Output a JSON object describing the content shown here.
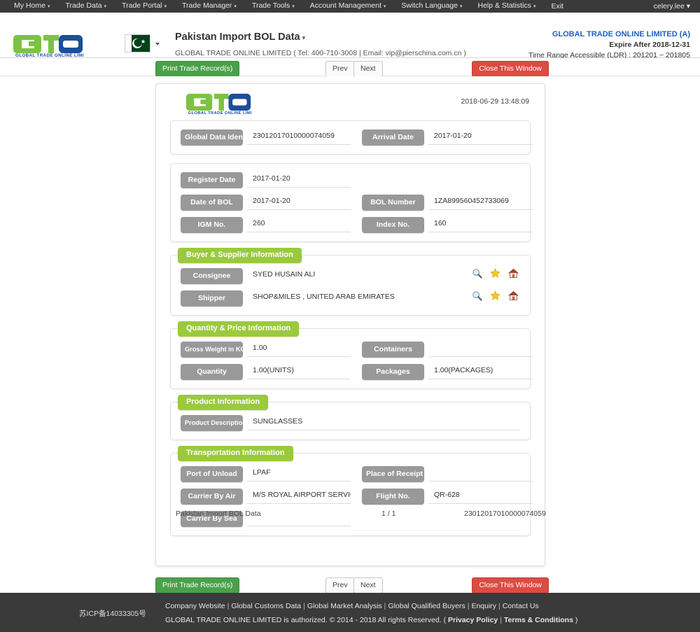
{
  "topnav": {
    "items": [
      {
        "label": "My Home",
        "caret": true
      },
      {
        "label": "Trade Data",
        "caret": true
      },
      {
        "label": "Trade Portal",
        "caret": true
      },
      {
        "label": "Trade Manager",
        "caret": true
      },
      {
        "label": "Trade Tools",
        "caret": true
      },
      {
        "label": "Account Management",
        "caret": true
      },
      {
        "label": "Switch Language",
        "caret": true
      },
      {
        "label": "Help & Statistics",
        "caret": true
      },
      {
        "label": "Exit",
        "caret": false
      }
    ],
    "user": "celery.lee"
  },
  "header": {
    "logo_text": "GLOBAL TRADE ONLINE LIMITED",
    "flag_country": "Pakistan",
    "page_title": "Pakistan Import BOL Data",
    "company_line": "GLOBAL TRADE ONLINE LIMITED ( Tel: 400-710-3008 | Email: vip@pierschina.com.cn )",
    "account_name": "GLOBAL TRADE ONLINE LIMITED (A)",
    "expire": "Expire After 2018-12-31",
    "time_range": "Time Range Accessible (LDR) : 201201 ~ 201805"
  },
  "toolbar": {
    "print_label": "Print Trade Record(s)",
    "prev_label": "Prev",
    "next_label": "Next",
    "close_label": "Close This Window"
  },
  "document": {
    "timestamp": "2018-06-29 13:48:09",
    "identity_section": {
      "rows": [
        {
          "label_left": "Global Data Identity",
          "value_left": "23012017010000074059",
          "label_right": "Arrival Date",
          "value_right": "2017-01-20"
        }
      ]
    },
    "bol_section": {
      "rows": [
        {
          "label_left": "Register Date",
          "value_left": "2017-01-20",
          "label_right": "",
          "value_right": ""
        },
        {
          "label_left": "Date of BOL",
          "value_left": "2017-01-20",
          "label_right": "BOL Number",
          "value_right": "1ZA899560452733069"
        },
        {
          "label_left": "IGM No.",
          "value_left": "260",
          "label_right": "Index No.",
          "value_right": "160"
        }
      ]
    },
    "buyer_supplier": {
      "title": "Buyer & Supplier Information",
      "rows": [
        {
          "label": "Consignee",
          "value": "SYED HUSAIN ALI"
        },
        {
          "label": "Shipper",
          "value": "SHOP&MILES , UNITED ARAB EMIRATES"
        }
      ],
      "icons": [
        "search-icon",
        "star-icon",
        "home-icon"
      ]
    },
    "quantity_price": {
      "title": "Quantity & Price Information",
      "rows": [
        {
          "label_left": "Gross Weight in KG",
          "value_left": "1.00",
          "label_right": "Containers",
          "value_right": ""
        },
        {
          "label_left": "Quantity",
          "value_left": "1.00(UNITS)",
          "label_right": "Packages",
          "value_right": "1.00(PACKAGES)"
        }
      ]
    },
    "product": {
      "title": "Product Information",
      "rows": [
        {
          "label": "Product Description",
          "value": "SUNGLASSES"
        }
      ]
    },
    "transportation": {
      "title": "Transportation Information",
      "rows": [
        {
          "label_left": "Port of Unload",
          "value_left": "LPAF",
          "label_right": "Place of Receipt",
          "value_right": ""
        },
        {
          "label_left": "Carrier By Air",
          "value_left": "M/S ROYAL AIRPORT SERVICES (P",
          "label_right": "Flight No.",
          "value_right": "QR-628"
        },
        {
          "label_left": "Carrier By Sea",
          "value_left": "",
          "label_right": "",
          "value_right": ""
        }
      ]
    },
    "footer": {
      "source": "Pakistan Import BOL Data",
      "page": "1 / 1",
      "identity": "23012017010000074059"
    }
  },
  "pagefooter": {
    "icp": "苏ICP备14033305号",
    "links": [
      "Company Website",
      "Global Customs Data",
      "Global Market Analysis",
      "Global Qualified Buyers",
      "Enquiry",
      "Contact Us"
    ],
    "copyright_prefix": "GLOBAL TRADE ONLINE LIMITED is authorized. © 2014 - 2018 All rights Reserved.  (",
    "privacy": "Privacy Policy",
    "terms": "Terms & Conditions",
    "copyright_suffix": ")"
  },
  "colors": {
    "nav_bg": "#3a3a3a",
    "section_green": "#9ACA3C",
    "pill_gray": "#999999",
    "print_green": "#4aa14a",
    "close_red": "#dd4b42",
    "link_blue": "#1f5fbf"
  }
}
